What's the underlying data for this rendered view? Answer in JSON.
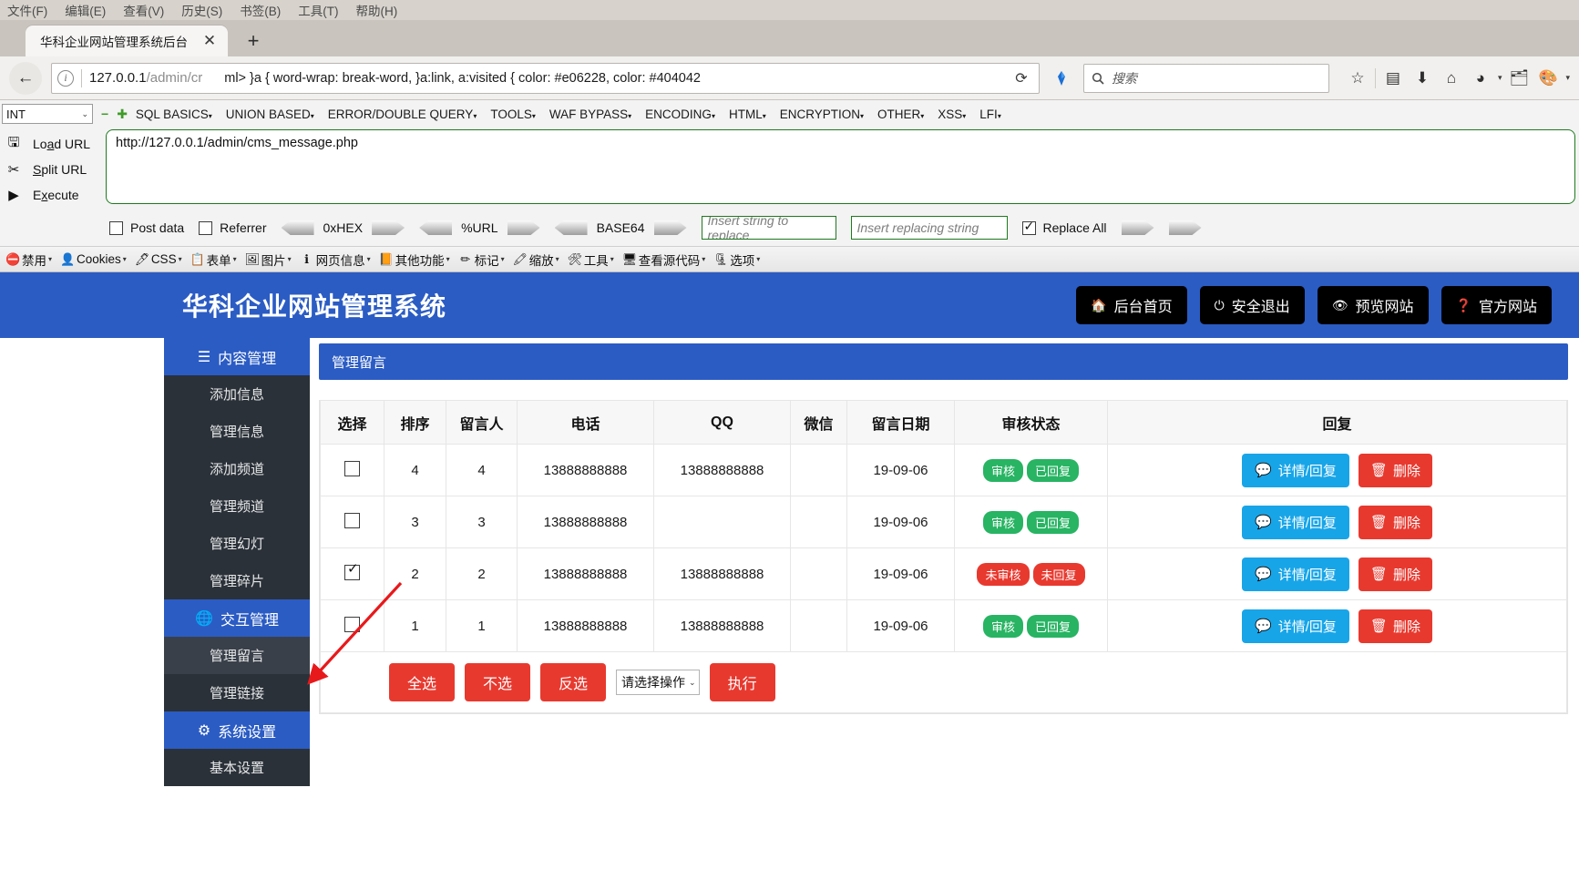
{
  "browser": {
    "menubar": [
      "文件(F)",
      "编辑(E)",
      "查看(V)",
      "历史(S)",
      "书签(B)",
      "工具(T)",
      "帮助(H)"
    ],
    "tab": {
      "title": "华科企业网站管理系统后台",
      "close": "✕",
      "newtab": "+"
    },
    "nav": {
      "back": "←",
      "url_host": "127.0.0.1",
      "url_path": "/admin/cr",
      "url_overflow": "ml>   }a { word-wrap: break-word, }a:link, a:visited { color: #e06228, color: #404042",
      "reload": "⟳",
      "search_placeholder": "搜索"
    }
  },
  "hackbar": {
    "type_select": "INT",
    "minus": "−",
    "plus": "✚",
    "menus": [
      "SQL BASICS",
      "UNION BASED",
      "ERROR/DOUBLE QUERY",
      "TOOLS",
      "WAF BYPASS",
      "ENCODING",
      "HTML",
      "ENCRYPTION",
      "OTHER",
      "XSS",
      "LFI"
    ],
    "actions": [
      {
        "label_pre": "Lo",
        "label_key": "a",
        "label_post": "d URL"
      },
      {
        "label_pre": "",
        "label_key": "S",
        "label_post": "plit URL"
      },
      {
        "label_pre": "E",
        "label_key": "x",
        "label_post": "ecute"
      }
    ],
    "url_value": "http://127.0.0.1/admin/cms_message.php",
    "post_data_label": "Post data",
    "referrer_label": "Referrer",
    "encoders": [
      "0xHEX",
      "%URL",
      "BASE64"
    ],
    "replace_from_placeholder": "Insert string to replace",
    "replace_to_placeholder": "Insert replacing string",
    "replace_all_label": "Replace All"
  },
  "devbar": [
    {
      "icon": "⛔",
      "label": "禁用"
    },
    {
      "icon": "👤",
      "label": "Cookies"
    },
    {
      "icon": "🖊",
      "label": "CSS"
    },
    {
      "icon": "📋",
      "label": "表单"
    },
    {
      "icon": "🖼",
      "label": "图片"
    },
    {
      "icon": "ℹ",
      "label": "网页信息"
    },
    {
      "icon": "📙",
      "label": "其他功能"
    },
    {
      "icon": "✏",
      "label": "标记"
    },
    {
      "icon": "🖍",
      "label": "缩放"
    },
    {
      "icon": "🛠",
      "label": "工具"
    },
    {
      "icon": "🖥",
      "label": "查看源代码"
    },
    {
      "icon": "🗜",
      "label": "选项"
    }
  ],
  "cms": {
    "logo": "华科企业网站管理系统",
    "nav_buttons": [
      {
        "icon": "🏠",
        "label": "后台首页"
      },
      {
        "icon": "⏻",
        "label": "安全退出"
      },
      {
        "icon": "👁",
        "label": "预览网站"
      },
      {
        "icon": "❓",
        "label": "官方网站"
      }
    ],
    "sidebar": [
      {
        "type": "group",
        "icon": "☰",
        "label": "内容管理"
      },
      {
        "type": "item",
        "label": "添加信息",
        "active": false
      },
      {
        "type": "item",
        "label": "管理信息",
        "active": false
      },
      {
        "type": "item",
        "label": "添加频道",
        "active": false
      },
      {
        "type": "item",
        "label": "管理频道",
        "active": false
      },
      {
        "type": "item",
        "label": "管理幻灯",
        "active": false
      },
      {
        "type": "item",
        "label": "管理碎片",
        "active": false
      },
      {
        "type": "group",
        "icon": "🌐",
        "label": "交互管理"
      },
      {
        "type": "item",
        "label": "管理留言",
        "active": true
      },
      {
        "type": "item",
        "label": "管理链接",
        "active": false
      },
      {
        "type": "group",
        "icon": "⚙",
        "label": "系统设置"
      },
      {
        "type": "item",
        "label": "基本设置",
        "active": false
      }
    ],
    "panel_title": "管理留言",
    "table": {
      "headers": [
        "选择",
        "排序",
        "留言人",
        "电话",
        "QQ",
        "微信",
        "留言日期",
        "审核状态",
        "回复"
      ],
      "rows": [
        {
          "checked": false,
          "order": "4",
          "name": "4",
          "phone": "13888888888",
          "qq": "13888888888",
          "wechat": "",
          "date": "19-09-06",
          "badges": [
            {
              "text": "审核",
              "color": "green"
            },
            {
              "text": "已回复",
              "color": "green"
            }
          ],
          "detail_label": "详情/回复",
          "delete_label": "删除"
        },
        {
          "checked": false,
          "order": "3",
          "name": "3",
          "phone": "13888888888",
          "qq": "",
          "wechat": "",
          "date": "19-09-06",
          "badges": [
            {
              "text": "审核",
              "color": "green"
            },
            {
              "text": "已回复",
              "color": "green"
            }
          ],
          "detail_label": "详情/回复",
          "delete_label": "删除"
        },
        {
          "checked": true,
          "order": "2",
          "name": "2",
          "phone": "13888888888",
          "qq": "13888888888",
          "wechat": "",
          "date": "19-09-06",
          "badges": [
            {
              "text": "未审核",
              "color": "red"
            },
            {
              "text": "未回复",
              "color": "red"
            }
          ],
          "detail_label": "详情/回复",
          "delete_label": "删除"
        },
        {
          "checked": false,
          "order": "1",
          "name": "1",
          "phone": "13888888888",
          "qq": "13888888888",
          "wechat": "",
          "date": "19-09-06",
          "badges": [
            {
              "text": "审核",
              "color": "green"
            },
            {
              "text": "已回复",
              "color": "green"
            }
          ],
          "detail_label": "详情/回复",
          "delete_label": "删除"
        }
      ]
    },
    "footer": {
      "select_all": "全选",
      "select_none": "不选",
      "invert": "反选",
      "action_select": "请选择操作",
      "execute": "执行"
    },
    "colors": {
      "brand_blue": "#2b5cc4",
      "sidebar_dark": "#2b3138",
      "badge_green": "#28b463",
      "badge_red": "#e8392f",
      "btn_blue": "#18a5e8",
      "annotation_arrow": "#e8191b"
    }
  }
}
